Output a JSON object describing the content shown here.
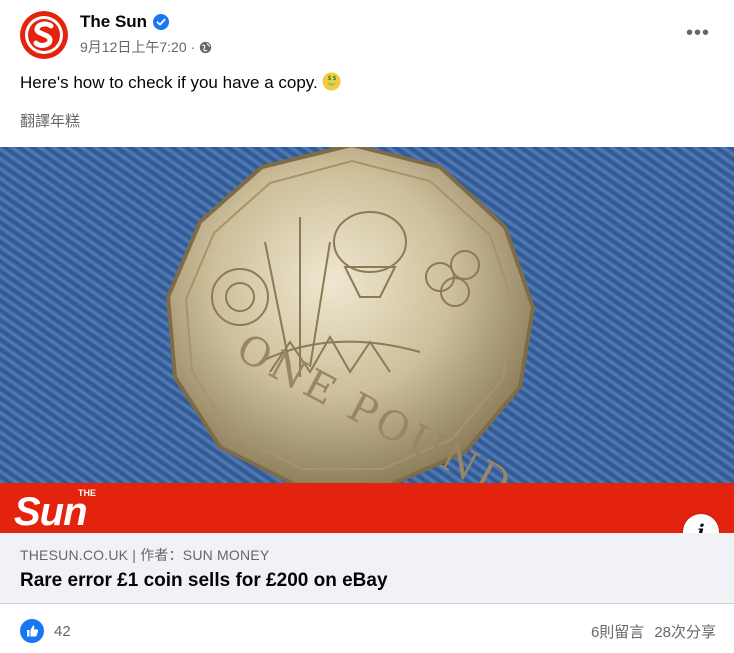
{
  "page": {
    "name": "The Sun",
    "timestamp": "9月12日上午7:20",
    "privacy_icon": "globe-icon",
    "verified_icon": "verified-badge-icon"
  },
  "post": {
    "text": "Here's how to check if you have a copy.",
    "emoji": "money-mouth-face-emoji",
    "translate_label": "翻譯年糕"
  },
  "image": {
    "coin_inscription": "ONE POUND",
    "brand_logo_text": "The Sun",
    "brand_color": "#e4230f"
  },
  "link": {
    "source": "THESUN.CO.UK | 作者：SUN MONEY",
    "title": "Rare error £1 coin sells for £200 on eBay"
  },
  "footer": {
    "reaction_count": "42",
    "comments": "6則留言",
    "shares": "28次分享",
    "accent_color": "#1877f2"
  }
}
